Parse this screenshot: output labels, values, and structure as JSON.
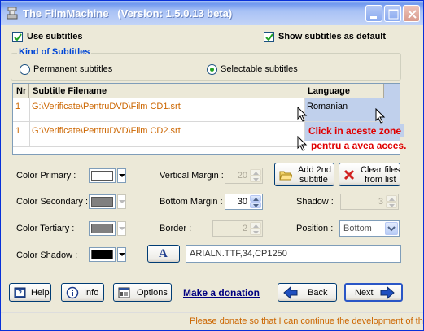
{
  "window": {
    "title": "The FilmMachine   (Version: 1.5.0.13 beta)",
    "icons": [
      "app-icon",
      "minimize-icon",
      "maximize-icon",
      "close-icon"
    ]
  },
  "options": {
    "use_subtitles": {
      "label": "Use subtitles",
      "checked": true
    },
    "show_default": {
      "label": "Show subtitles as default",
      "checked": true
    }
  },
  "kind": {
    "title": "Kind of Subtitles",
    "permanent": {
      "label": "Permanent subtitles",
      "selected": false
    },
    "selectable": {
      "label": "Selectable subtitles",
      "selected": true
    }
  },
  "grid": {
    "headers": [
      "Nr",
      "Subtitle Filename",
      "Language"
    ],
    "rows": [
      {
        "nr": "1",
        "file": "G:\\Verificate\\PentruDVD\\Film CD1.srt",
        "language": "Romanian"
      },
      {
        "nr": "1",
        "file": "G:\\Verificate\\PentruDVD\\Film CD2.srt",
        "language": ""
      }
    ]
  },
  "annotation": {
    "line1": "Click in aceste zone",
    "line2": "pentru a avea acces."
  },
  "colors": {
    "primary": {
      "label": "Color Primary :",
      "swatch": "#ffffff"
    },
    "secondary": {
      "label": "Color Secondary :",
      "swatch": "#808080"
    },
    "tertiary": {
      "label": "Color Tertiary :",
      "swatch": "#808080"
    },
    "shadow": {
      "label": "Color Shadow :",
      "swatch": "#000000"
    }
  },
  "margins": {
    "vertical": {
      "label": "Vertical Margin :",
      "value": "20"
    },
    "bottom": {
      "label": "Bottom Margin :",
      "value": "30"
    },
    "border": {
      "label": "Border :",
      "value": "2"
    },
    "shadow": {
      "label": "Shadow :",
      "value": "3"
    },
    "position": {
      "label": "Position :",
      "value": "Bottom"
    }
  },
  "buttons": {
    "add_line1": "Add 2nd",
    "add_line2": "subtitle",
    "clear_line1": "Clear files",
    "clear_line2": "from list",
    "font_letter": "A",
    "help": "Help",
    "info": "Info",
    "options": "Options",
    "donate": "Make a donation",
    "back": "Back",
    "next": "Next"
  },
  "font_field": {
    "value": "ARIALN.TTF,34,CP1250"
  },
  "status": {
    "text": "Please donate so that I can continue the development of thi"
  },
  "accent": {
    "orange": "#cc6600",
    "annotation_red": "#e00000",
    "selection_blue": "#c0d0ec"
  }
}
